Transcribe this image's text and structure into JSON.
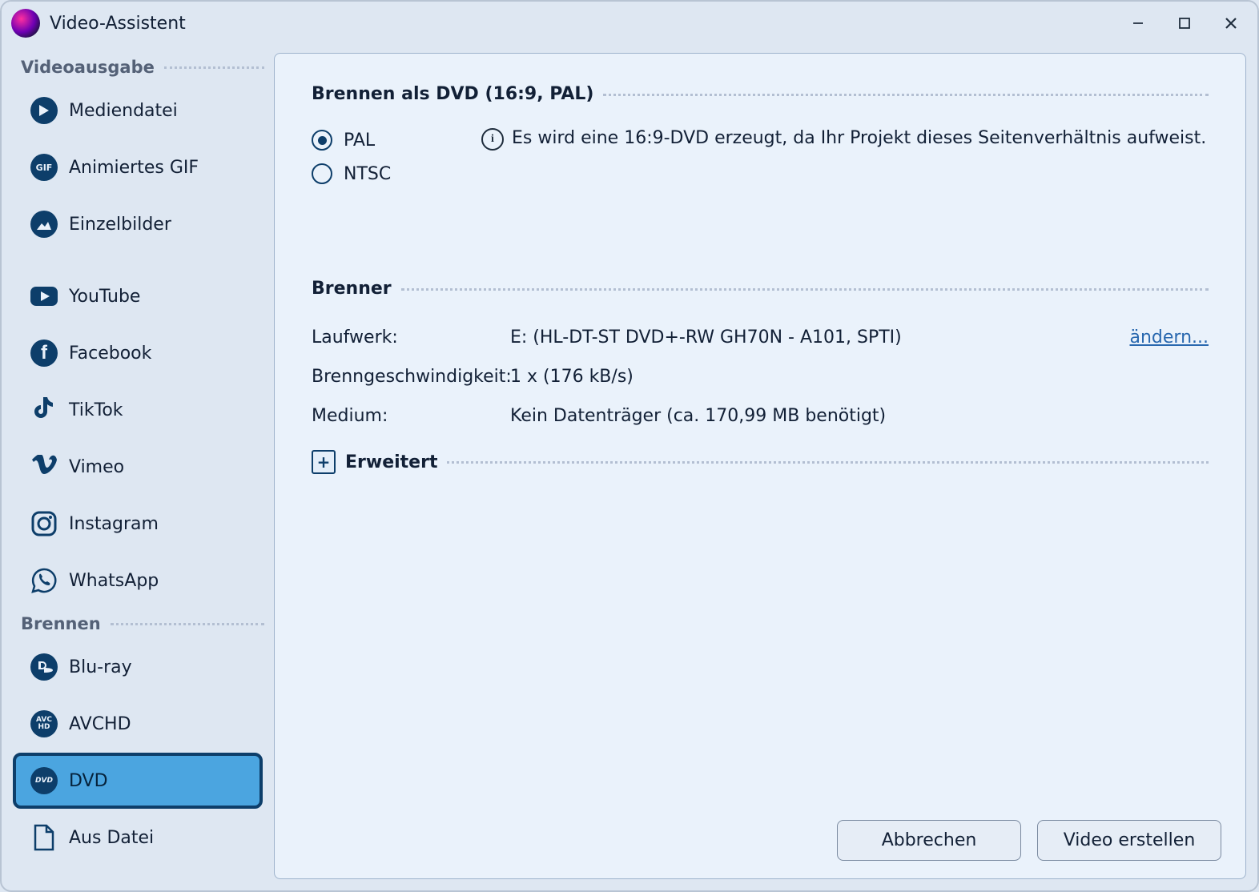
{
  "app": {
    "title": "Video-Assistent"
  },
  "sidebar": {
    "groups": [
      {
        "id": "output",
        "label": "Videoausgabe",
        "items": [
          {
            "id": "media-file",
            "label": "Mediendatei",
            "icon": "play-icon",
            "selected": false
          },
          {
            "id": "animated-gif",
            "label": "Animiertes GIF",
            "icon": "gif-icon",
            "selected": false
          },
          {
            "id": "single-images",
            "label": "Einzelbilder",
            "icon": "image-icon",
            "selected": false
          }
        ]
      },
      {
        "id": "social",
        "label": "",
        "items": [
          {
            "id": "youtube",
            "label": "YouTube",
            "icon": "youtube-icon",
            "selected": false
          },
          {
            "id": "facebook",
            "label": "Facebook",
            "icon": "facebook-icon",
            "selected": false
          },
          {
            "id": "tiktok",
            "label": "TikTok",
            "icon": "tiktok-icon",
            "selected": false
          },
          {
            "id": "vimeo",
            "label": "Vimeo",
            "icon": "vimeo-icon",
            "selected": false
          },
          {
            "id": "instagram",
            "label": "Instagram",
            "icon": "instagram-icon",
            "selected": false
          },
          {
            "id": "whatsapp",
            "label": "WhatsApp",
            "icon": "whatsapp-icon",
            "selected": false
          }
        ]
      },
      {
        "id": "burn",
        "label": "Brennen",
        "items": [
          {
            "id": "bluray",
            "label": "Blu-ray",
            "icon": "bluray-icon",
            "selected": false
          },
          {
            "id": "avchd",
            "label": "AVCHD",
            "icon": "avchd-icon",
            "selected": false
          },
          {
            "id": "dvd",
            "label": "DVD",
            "icon": "dvd-icon",
            "selected": true
          },
          {
            "id": "from-file",
            "label": "Aus Datei",
            "icon": "file-icon",
            "selected": false
          }
        ]
      }
    ]
  },
  "main": {
    "section1": {
      "title": "Brennen als DVD (16:9, PAL)",
      "radios": {
        "pal": {
          "label": "PAL",
          "checked": true
        },
        "ntsc": {
          "label": "NTSC",
          "checked": false
        }
      },
      "info": "Es wird eine 16:9-DVD erzeugt, da Ihr Projekt dieses Seitenverhältnis aufweist."
    },
    "section2": {
      "title": "Brenner",
      "drive": {
        "label": "Laufwerk:",
        "value": "E: (HL-DT-ST DVD+-RW GH70N - A101, SPTI)",
        "change": "ändern..."
      },
      "speed": {
        "label": "Brenngeschwindigkeit:",
        "value": "1 x (176 kB/s)"
      },
      "medium": {
        "label": "Medium:",
        "value": "Kein Datenträger (ca. 170,99 MB benötigt)"
      }
    },
    "expander": {
      "label": "Erweitert"
    }
  },
  "footer": {
    "cancel": "Abbrechen",
    "create": "Video erstellen"
  },
  "icons": {
    "gif_text": "GIF",
    "avchd_top": "AVC",
    "avchd_bottom": "HD",
    "dvd_text": "DVD"
  }
}
